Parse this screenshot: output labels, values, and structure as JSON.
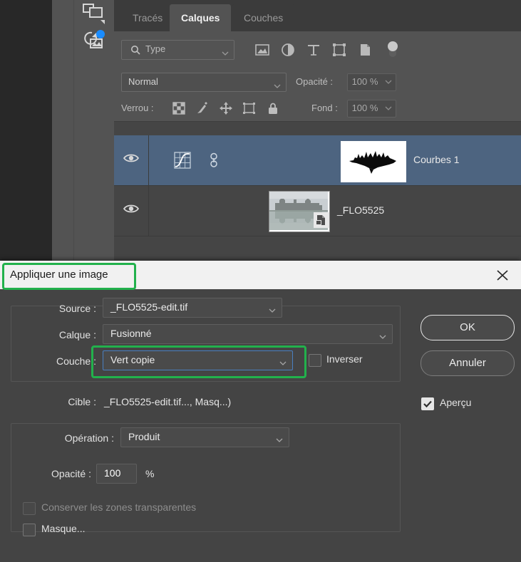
{
  "app": {
    "panel": {
      "tabs": [
        {
          "label": "Tracés",
          "active": false
        },
        {
          "label": "Calques",
          "active": true
        },
        {
          "label": "Couches",
          "active": false
        }
      ],
      "filter": {
        "placeholder": "Type",
        "icons": [
          "image-filter-icon",
          "adjustment-filter-icon",
          "text-filter-icon",
          "shape-filter-icon",
          "smart-object-filter-icon",
          "filter-toggle-switch"
        ]
      },
      "blend": {
        "mode": "Normal",
        "opacity_label": "Opacité :",
        "opacity_value": "100 %"
      },
      "lock": {
        "label": "Verrou :",
        "icons": [
          "lock-transparent-pixels-icon",
          "lock-image-pixels-icon",
          "lock-position-icon",
          "lock-artboard-nesting-icon",
          "lock-all-icon"
        ],
        "fill_label": "Fond :",
        "fill_value": "100 %"
      },
      "layers": [
        {
          "name": "Courbes 1",
          "selected": true,
          "visible": true,
          "kind": "adjustment-curves",
          "linked": true
        },
        {
          "name": "_FLO5525",
          "selected": false,
          "visible": true,
          "kind": "smart-object",
          "linked": false
        }
      ]
    },
    "toolbar": {
      "items": [
        {
          "name": "artboard-frame-tool"
        },
        {
          "name": "rotate-image-tool",
          "badge": true
        }
      ]
    }
  },
  "dialog": {
    "title": "Appliquer une image",
    "close_label": "✕",
    "source": {
      "label": "Source :",
      "value": "_FLO5525-edit.tif"
    },
    "layer": {
      "label": "Calque :",
      "value": "Fusionné"
    },
    "channel": {
      "label": "Couche :",
      "value": "Vert copie"
    },
    "invert": {
      "label": "Inverser",
      "checked": false
    },
    "target": {
      "label": "Cible :",
      "value": "_FLO5525-edit.tif..., Masq...)"
    },
    "operation": {
      "label": "Opération :",
      "value": "Produit"
    },
    "opacity": {
      "label": "Opacité :",
      "value": "100",
      "unit": "%"
    },
    "preserve_transparency": {
      "label": "Conserver les zones transparentes",
      "checked": false,
      "disabled": true
    },
    "mask": {
      "label": "Masque...",
      "checked": false
    },
    "buttons": {
      "ok": "OK",
      "cancel": "Annuler"
    },
    "preview": {
      "label": "Aperçu",
      "checked": true
    },
    "highlight_color": "#22b14c",
    "focus_color": "#4a7fc1"
  }
}
